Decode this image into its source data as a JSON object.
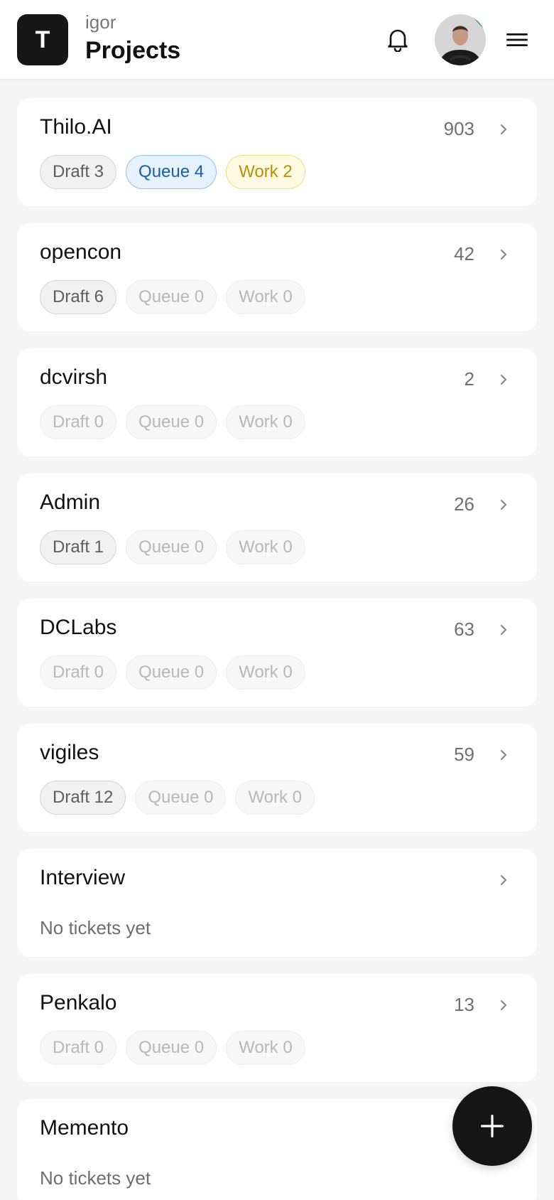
{
  "header": {
    "logo_letter": "T",
    "user_name": "igor",
    "title": "Projects"
  },
  "projects": [
    {
      "name": "Thilo.AI",
      "count": "903",
      "pills": [
        {
          "label": "Draft 3",
          "style": "on-gray"
        },
        {
          "label": "Queue 4",
          "style": "on-blue"
        },
        {
          "label": "Work 2",
          "style": "on-yellow"
        }
      ]
    },
    {
      "name": "opencon",
      "count": "42",
      "pills": [
        {
          "label": "Draft 6",
          "style": "on-gray"
        },
        {
          "label": "Queue 0",
          "style": "off"
        },
        {
          "label": "Work 0",
          "style": "off"
        }
      ]
    },
    {
      "name": "dcvirsh",
      "count": "2",
      "pills": [
        {
          "label": "Draft 0",
          "style": "off"
        },
        {
          "label": "Queue 0",
          "style": "off"
        },
        {
          "label": "Work 0",
          "style": "off"
        }
      ]
    },
    {
      "name": "Admin",
      "count": "26",
      "pills": [
        {
          "label": "Draft 1",
          "style": "on-gray"
        },
        {
          "label": "Queue 0",
          "style": "off"
        },
        {
          "label": "Work 0",
          "style": "off"
        }
      ]
    },
    {
      "name": "DCLabs",
      "count": "63",
      "pills": [
        {
          "label": "Draft 0",
          "style": "off"
        },
        {
          "label": "Queue 0",
          "style": "off"
        },
        {
          "label": "Work 0",
          "style": "off"
        }
      ]
    },
    {
      "name": "vigiles",
      "count": "59",
      "pills": [
        {
          "label": "Draft 12",
          "style": "on-gray"
        },
        {
          "label": "Queue 0",
          "style": "off"
        },
        {
          "label": "Work 0",
          "style": "off"
        }
      ]
    },
    {
      "name": "Interview",
      "empty_text": "No tickets yet"
    },
    {
      "name": "Penkalo",
      "count": "13",
      "pills": [
        {
          "label": "Draft 0",
          "style": "off"
        },
        {
          "label": "Queue 0",
          "style": "off"
        },
        {
          "label": "Work 0",
          "style": "off"
        }
      ]
    },
    {
      "name": "Memento",
      "empty_text": "No tickets yet"
    }
  ],
  "icons": {
    "bell": "bell-icon",
    "menu": "hamburger-menu-icon",
    "chevron": "chevron-right-icon",
    "add": "plus-icon"
  },
  "colors": {
    "background": "#f5f5f5",
    "dark": "#151515",
    "queue_active": "#1d5ea9",
    "work_active": "#b98f08"
  }
}
